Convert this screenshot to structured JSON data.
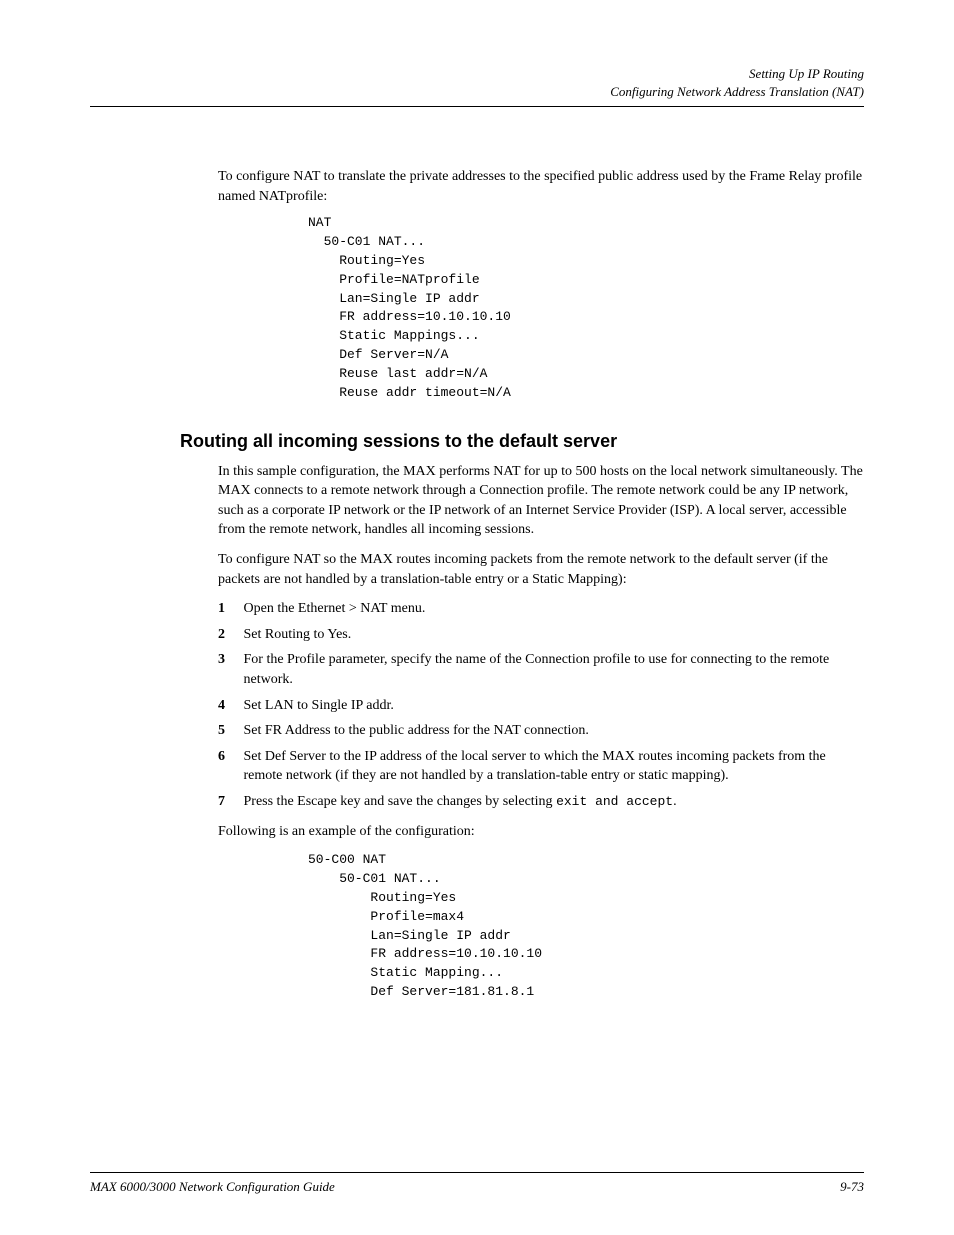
{
  "header": {
    "title": "Setting Up IP Routing",
    "sub": "Configuring Network Address Translation (NAT)"
  },
  "para1": "To configure NAT to translate the private addresses to the specified public address used by the Frame Relay profile named NATprofile:",
  "code1": "NAT\n  50-C01 NAT...\n    Routing=Yes\n    Profile=NATprofile\n    Lan=Single IP addr\n    FR address=10.10.10.10\n    Static Mappings...\n    Def Server=N/A\n    Reuse last addr=N/A\n    Reuse addr timeout=N/A",
  "sectionTitle": "Routing all incoming sessions to the default server",
  "para2": "In this sample configuration, the MAX performs NAT for up to 500 hosts on the local network simultaneously. The MAX connects to a remote network through a Connection profile. The remote network could be any IP network, such as a corporate IP network or the IP network of an Internet Service Provider (ISP). A local server, accessible from the remote network, handles all incoming sessions.",
  "para3": "To configure NAT so the MAX routes incoming packets from the remote network to the default server (if the packets are not handled by a translation-table entry or a Static Mapping):",
  "steps": [
    {
      "n": "1",
      "t": "Open the Ethernet > NAT menu."
    },
    {
      "n": "2",
      "t": "Set Routing to Yes."
    },
    {
      "n": "3",
      "t": "For the Profile parameter, specify the name of the Connection profile to use for connecting to the remote network."
    },
    {
      "n": "4",
      "t": "Set LAN to Single IP addr."
    },
    {
      "n": "5",
      "t": "Set FR Address to the public address for the NAT connection."
    },
    {
      "n": "6",
      "t": "Set Def Server to the IP address of the local server to which the MAX routes incoming packets from the remote network (if they are not handled by a translation-table entry or static mapping)."
    },
    {
      "n": "7",
      "t_pre": "Press the Escape key and save the changes by selecting ",
      "t_code": "exit and accept",
      "t_post": "."
    }
  ],
  "para4": "Following is an example of the configuration:",
  "code2": "50-C00 NAT\n    50-C01 NAT...\n        Routing=Yes\n        Profile=max4\n        Lan=Single IP addr\n        FR address=10.10.10.10\n        Static Mapping...\n        Def Server=181.81.8.1",
  "footer": {
    "left": "MAX 6000/3000 Network Configuration Guide",
    "right": "9-73"
  }
}
